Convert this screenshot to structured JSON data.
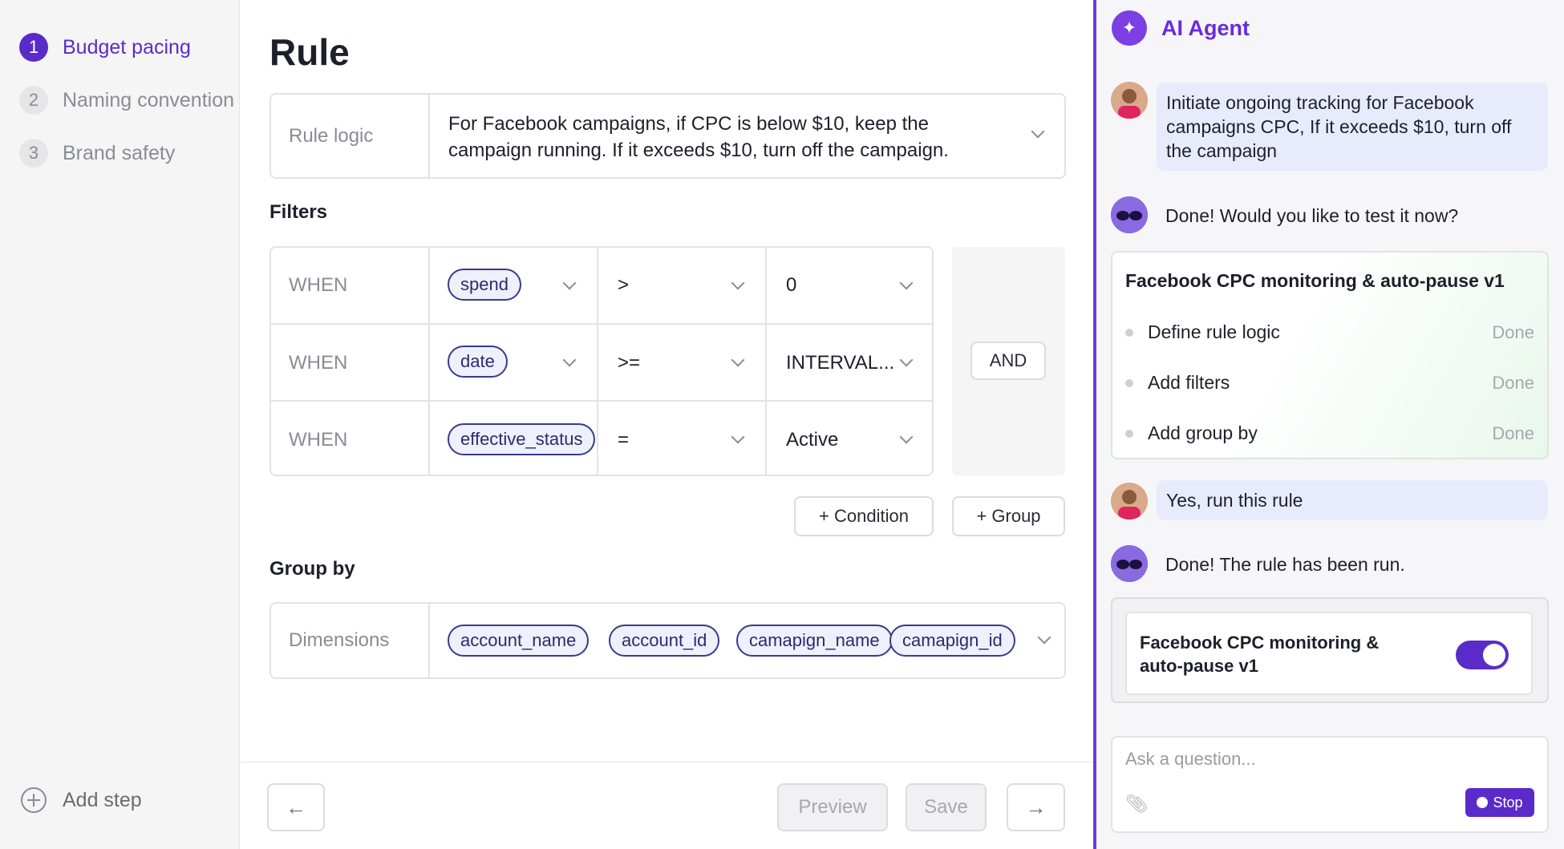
{
  "steps": {
    "items": [
      {
        "num": "1",
        "label": "Budget pacing"
      },
      {
        "num": "2",
        "label": "Naming convention"
      },
      {
        "num": "3",
        "label": "Brand safety"
      }
    ],
    "add_label": "Add step"
  },
  "main": {
    "title": "Rule",
    "rule_logic": {
      "label": "Rule logic",
      "text": "For Facebook campaigns, if CPC is below $10, keep the campaign running. If it exceeds $10, turn off the campaign."
    },
    "filters": {
      "title": "Filters",
      "rows": [
        {
          "when": "WHEN",
          "field": "spend",
          "op": ">",
          "value": "0"
        },
        {
          "when": "WHEN",
          "field": "date",
          "op": ">=",
          "value": "INTERVAL..."
        },
        {
          "when": "WHEN",
          "field": "effective_status",
          "op": "=",
          "value": "Active"
        }
      ],
      "and_label": "AND",
      "add_condition": "+ Condition",
      "add_group": "+ Group"
    },
    "group_by": {
      "title": "Group by",
      "label": "Dimensions",
      "dimensions": [
        "account_name",
        "account_id",
        "camapign_name",
        "camapign_id"
      ]
    },
    "footer": {
      "back": "←",
      "preview": "Preview",
      "save": "Save",
      "next": "→"
    }
  },
  "agent": {
    "title": "AI Agent",
    "messages": {
      "user1": "Initiate ongoing tracking for Facebook campaigns CPC, If it exceeds $10, turn off the campaign",
      "bot1": "Done! Would you like to test it now?",
      "user2": "Yes, run this rule",
      "bot2": "Done! The rule has been run."
    },
    "task_card": {
      "title": "Facebook CPC monitoring & auto-pause v1",
      "tasks": [
        {
          "label": "Define rule logic",
          "status": "Done"
        },
        {
          "label": "Add filters",
          "status": "Done"
        },
        {
          "label": "Add group by",
          "status": "Done"
        }
      ]
    },
    "rule_card": {
      "name": "Facebook CPC monitoring & auto-pause v1",
      "enabled": true
    },
    "composer": {
      "placeholder": "Ask a question...",
      "stop_label": "Stop"
    }
  },
  "colors": {
    "accent": "#5a2bc9",
    "agent_title": "#6a2be0",
    "pill_border": "#3a3a8c"
  }
}
